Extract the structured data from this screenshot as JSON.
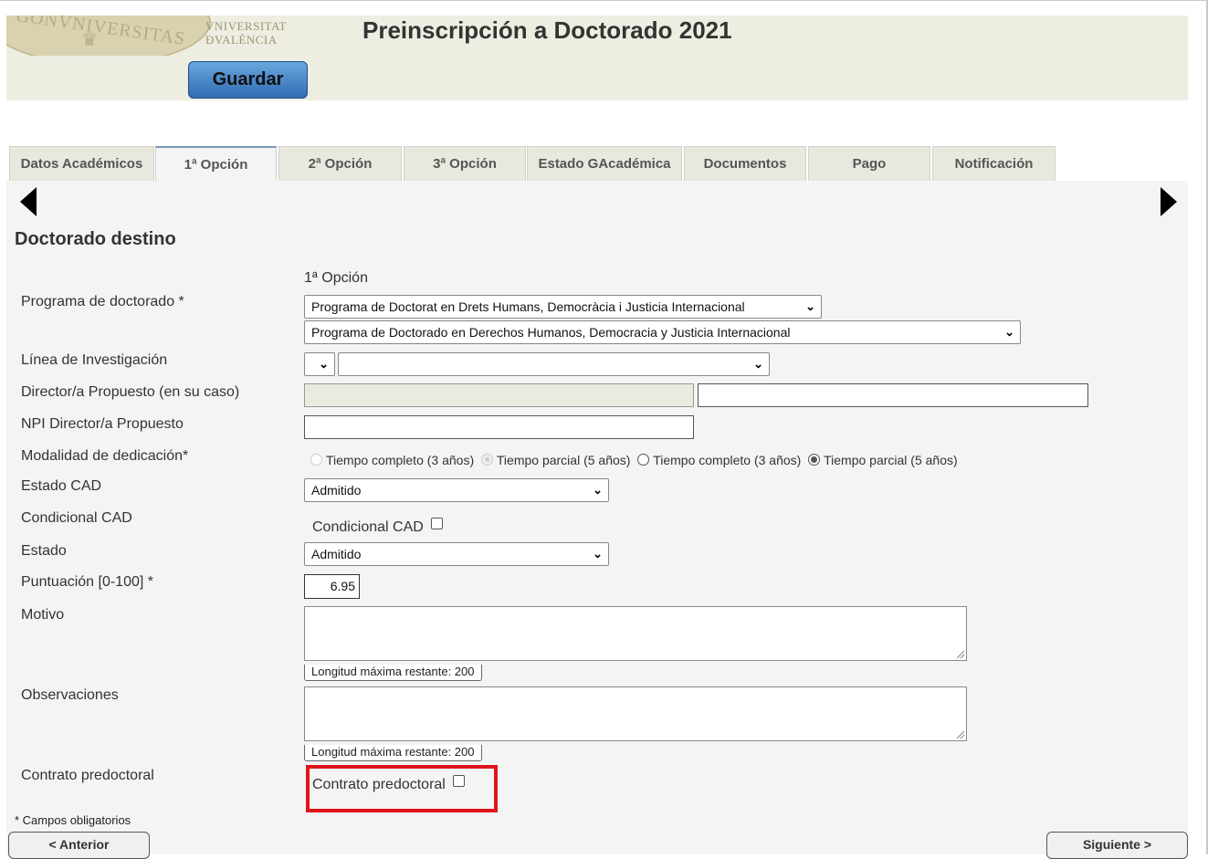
{
  "header": {
    "university_name": "VNIVERSITAT D VALÈNCIA",
    "university_line1": "VNIVERSITAT",
    "university_line2": "ĐVALÈNCIA",
    "crest_text": "GONVNIVERSITAS • VALENTINA",
    "title": "Preinscripción a Doctorado 2021",
    "save_label": "Guardar"
  },
  "tabs": [
    {
      "label": "Datos Académicos",
      "active": false
    },
    {
      "label": "1ª Opción",
      "active": true
    },
    {
      "label": "2ª Opción",
      "active": false
    },
    {
      "label": "3ª Opción",
      "active": false
    },
    {
      "label": "Estado GAcadémica",
      "active": false
    },
    {
      "label": "Documentos",
      "active": false
    },
    {
      "label": "Pago",
      "active": false
    },
    {
      "label": "Notificación",
      "active": false
    }
  ],
  "section": {
    "title": "Doctorado destino",
    "column_header": "1ª Opción"
  },
  "form": {
    "programa": {
      "label": "Programa de doctorado *",
      "value_va": "Programa de Doctorat en Drets Humans, Democràcia i Justicia Internacional",
      "value_es": "Programa de Doctorado en Derechos Humanos, Democracia y Justicia Internacional"
    },
    "linea": {
      "label": "Línea de Investigación",
      "value_code": "",
      "value": ""
    },
    "director": {
      "label": "Director/a Propuesto (en su caso)",
      "value_code": "",
      "value": ""
    },
    "npi": {
      "label": "NPI Director/a Propuesto",
      "value": ""
    },
    "modalidad": {
      "label": "Modalidad de dedicación*",
      "options": [
        {
          "label": "Tiempo completo (3 años)",
          "state": "disabled"
        },
        {
          "label": "Tiempo parcial (5 años)",
          "state": "disabled-checked"
        },
        {
          "label": "Tiempo completo (3 años)",
          "state": "unchecked"
        },
        {
          "label": "Tiempo parcial (5 años)",
          "state": "checked"
        }
      ]
    },
    "estado_cad": {
      "label": "Estado CAD",
      "value": "Admitido"
    },
    "condicional_cad": {
      "label": "Condicional CAD",
      "checkbox_label": "Condicional CAD",
      "checked": false
    },
    "estado": {
      "label": "Estado",
      "value": "Admitido"
    },
    "puntuacion": {
      "label": "Puntuación [0-100] *",
      "value": "6.95"
    },
    "motivo": {
      "label": "Motivo",
      "value": "",
      "counter": "Longitud máxima restante: 200"
    },
    "observaciones": {
      "label": "Observaciones",
      "value": "",
      "counter": "Longitud máxima restante: 200"
    },
    "contrato": {
      "label": "Contrato predoctoral",
      "checkbox_label": "Contrato predoctoral",
      "checked": false
    }
  },
  "footer": {
    "required_note": "* Campos obligatorios",
    "prev_label": "< Anterior",
    "next_label": "Siguiente >"
  },
  "colors": {
    "header_bg": "#eeede2",
    "save_button": "#3f7fc4",
    "highlight": "#e0141b",
    "content_bg": "#f4f4f4"
  }
}
